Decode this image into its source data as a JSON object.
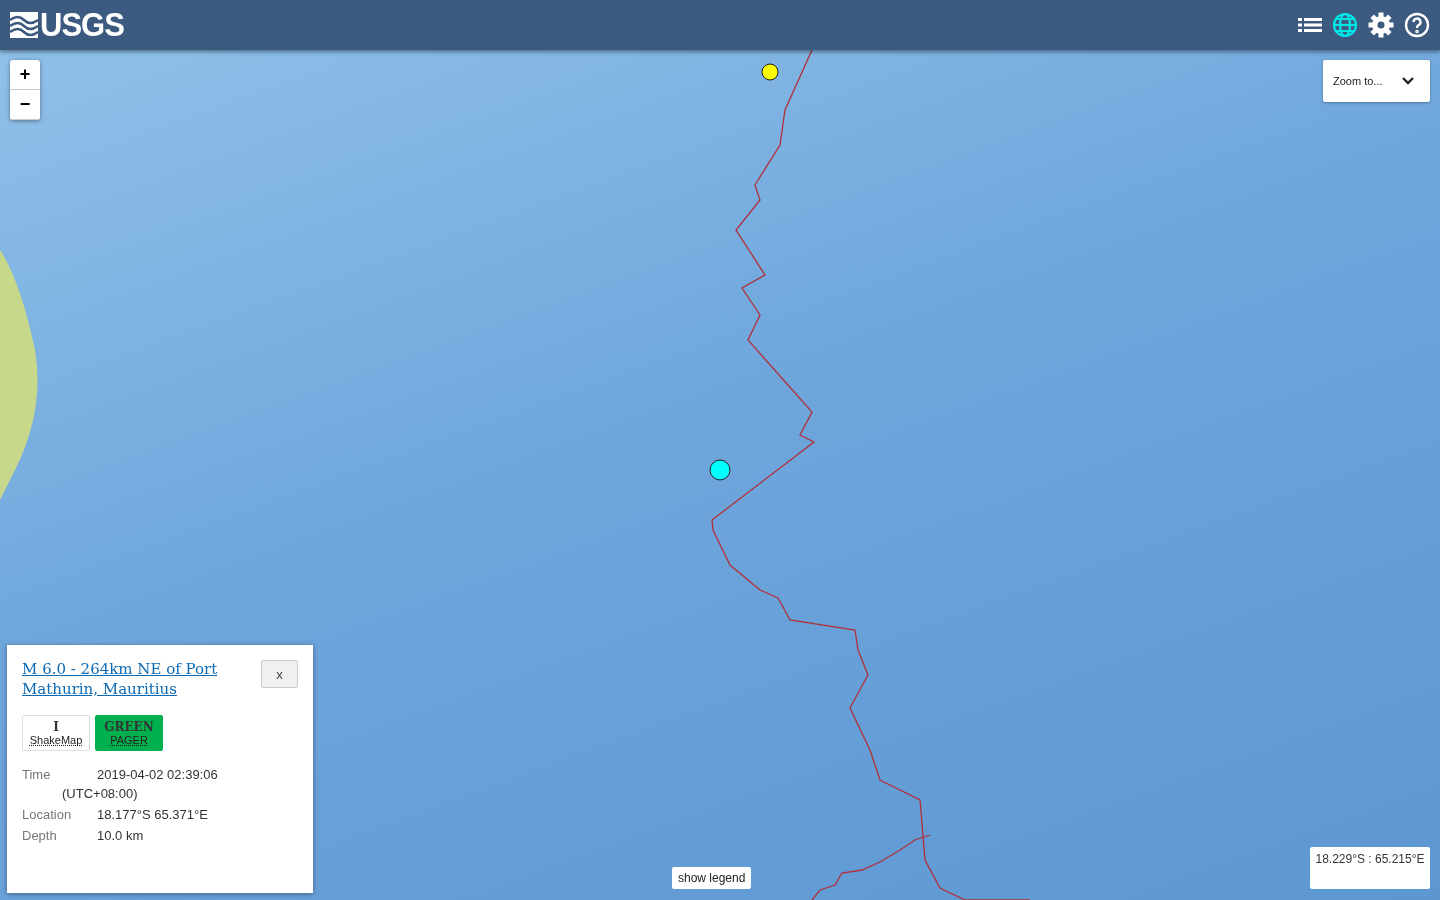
{
  "header": {
    "logo": "USGS",
    "icons": [
      {
        "kind": "list",
        "selected": false
      },
      {
        "kind": "globe",
        "selected": true
      },
      {
        "kind": "gear",
        "selected": false
      },
      {
        "kind": "help",
        "selected": false
      }
    ]
  },
  "map": {
    "zoom_buttons": [
      "+",
      "−"
    ],
    "zoom_to": {
      "label": "Zoom to..."
    },
    "earthquakes": [
      {
        "color": "#ffff00"
      },
      {
        "color": "#00ffff"
      }
    ],
    "legend_button": "show legend",
    "coordinates": "18.229°S : 65.215°E"
  },
  "popup": {
    "title": "M 6.0 - 264km NE of Port Mathurin, Mauritius",
    "close": "x",
    "badges": [
      {
        "value": "I",
        "label": "ShakeMap",
        "color": "#ffffff"
      },
      {
        "value": "GREEN",
        "label": "PAGER",
        "color": "#00b04f"
      }
    ],
    "details": [
      {
        "label": "Time",
        "value": "2019-04-02 02:39:06",
        "note": "(UTC+08:00)"
      },
      {
        "label": "Location",
        "value": "18.177°S 65.371°E"
      },
      {
        "label": "Depth",
        "value": "10.0 km"
      }
    ]
  }
}
